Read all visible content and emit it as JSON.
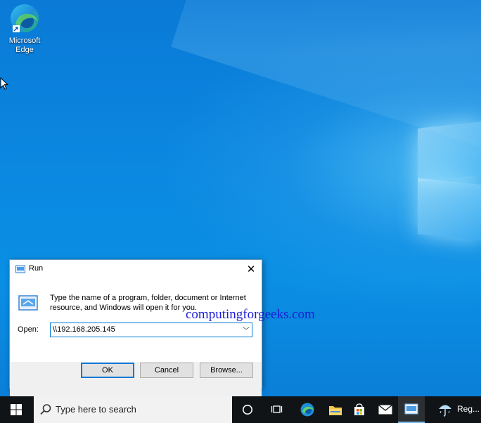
{
  "desktop": {
    "icons": [
      {
        "name": "edge-icon",
        "label_line1": "Microsoft",
        "label_line2": "Edge"
      }
    ]
  },
  "run_dialog": {
    "title": "Run",
    "description": "Type the name of a program, folder, document or Internet resource, and Windows will open it for you.",
    "open_label": "Open:",
    "open_value": "\\\\192.168.205.145",
    "ok_label": "OK",
    "cancel_label": "Cancel",
    "browse_label": "Browse..."
  },
  "watermark": "computingforgeeks.com",
  "taskbar": {
    "search_placeholder": "Type here to search",
    "weather_label": "Reg...",
    "accent_color": "#76b9ed"
  }
}
